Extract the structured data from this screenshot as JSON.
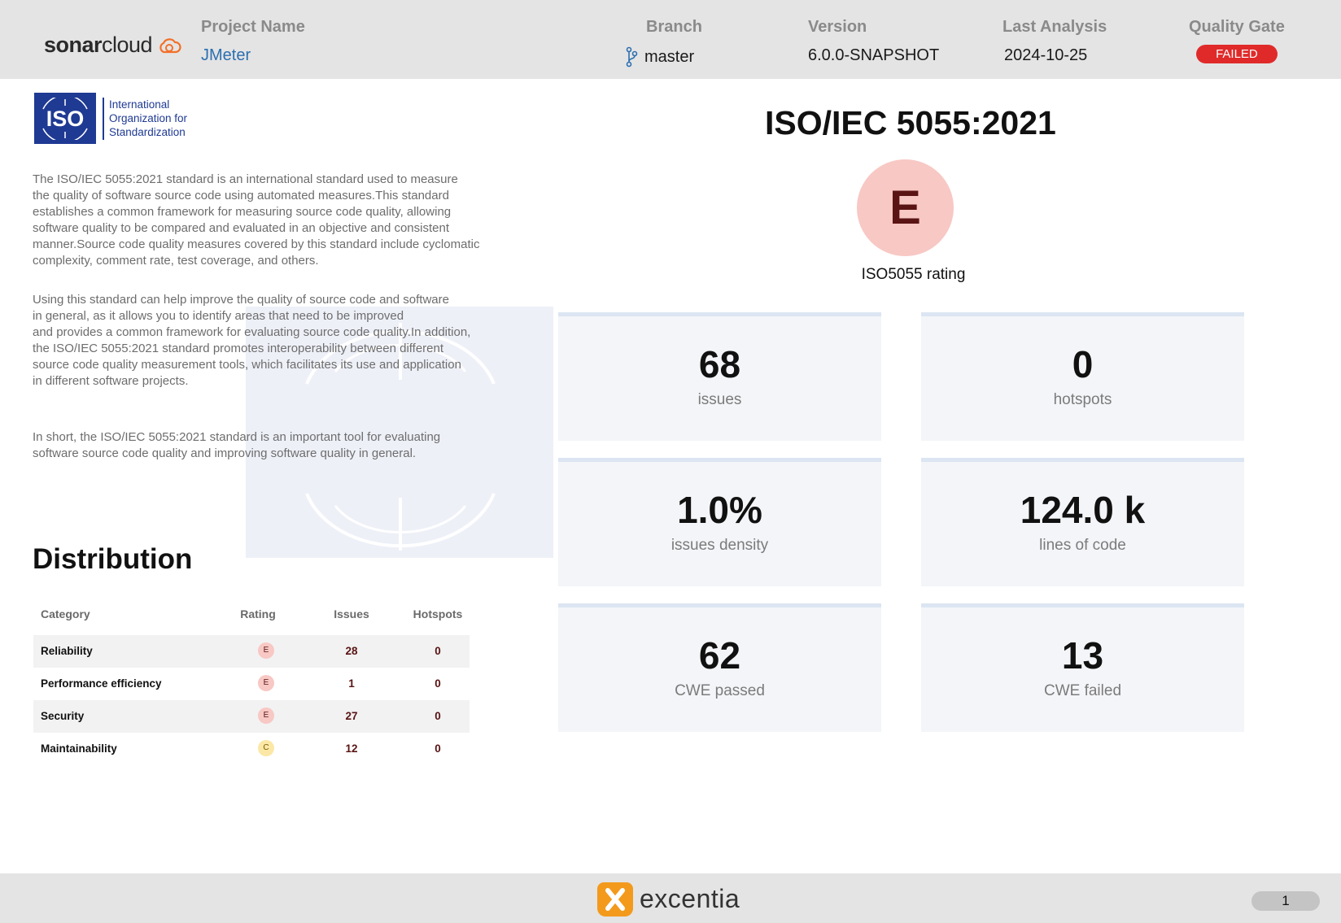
{
  "header": {
    "logo_brand": "sonarcloud",
    "project_label": "Project Name",
    "project_value": "JMeter",
    "branch_label": "Branch",
    "branch_value": "master",
    "version_label": "Version",
    "version_value": "6.0.0-SNAPSHOT",
    "last_analysis_label": "Last Analysis",
    "last_analysis_value": "2024-10-25",
    "quality_gate_label": "Quality Gate",
    "quality_gate_value": "FAILED",
    "quality_gate_color": "#e02a2a"
  },
  "iso_logo": {
    "mark": "ISO",
    "name_lines": [
      "International",
      "Organization for",
      "Standardization"
    ]
  },
  "intro": {
    "paragraph1": [
      "The ISO/IEC 5055:2021 standard is an international standard used to measure",
      "the quality of software source code using automated measures.This standard",
      "establishes a common framework for measuring source code quality, allowing",
      "software quality to be compared and evaluated in an objective and consistent",
      "manner.Source code quality measures covered by this standard include cyclomatic",
      "complexity, comment rate, test coverage, and others."
    ],
    "paragraph2": [
      "Using this standard can help improve the quality of source code and software",
      "in general, as it allows you to identify areas that need to be improved",
      "and provides a common framework for evaluating source code quality.In addition,",
      "the ISO/IEC 5055:2021 standard promotes interoperability between different",
      "source code quality measurement tools, which facilitates its use and application",
      "in different software projects."
    ],
    "paragraph3": [
      "In short, the ISO/IEC 5055:2021 standard is an important tool for evaluating",
      "software source code quality and improving software quality in general."
    ]
  },
  "distribution": {
    "title": "Distribution",
    "columns": [
      "Category",
      "Rating",
      "Issues",
      "Hotspots"
    ],
    "rows": [
      {
        "category": "Reliability",
        "rating": "E",
        "issues": "28",
        "hotspots": "0"
      },
      {
        "category": "Performance efficiency",
        "rating": "E",
        "issues": "1",
        "hotspots": "0"
      },
      {
        "category": "Security",
        "rating": "E",
        "issues": "27",
        "hotspots": "0"
      },
      {
        "category": "Maintainability",
        "rating": "C",
        "issues": "12",
        "hotspots": "0"
      }
    ]
  },
  "summary": {
    "title": "ISO/IEC 5055:2021",
    "rating": "E",
    "rating_label": "ISO5055 rating",
    "rating_colors": {
      "E": {
        "bg": "#f8c8c4",
        "fg": "#5a1414"
      },
      "C": {
        "bg": "#fbe8a6",
        "fg": "#7a5a00"
      }
    }
  },
  "metrics": [
    {
      "value": "68",
      "label": "issues"
    },
    {
      "value": "0",
      "label": "hotspots"
    },
    {
      "value": "1.0%",
      "label": "issues density"
    },
    {
      "value": "124.0 k",
      "label": "lines of code"
    },
    {
      "value": "62",
      "label": "CWE passed"
    },
    {
      "value": "13",
      "label": "CWE failed"
    }
  ],
  "footer": {
    "brand": "excentia",
    "page_number": "1"
  }
}
